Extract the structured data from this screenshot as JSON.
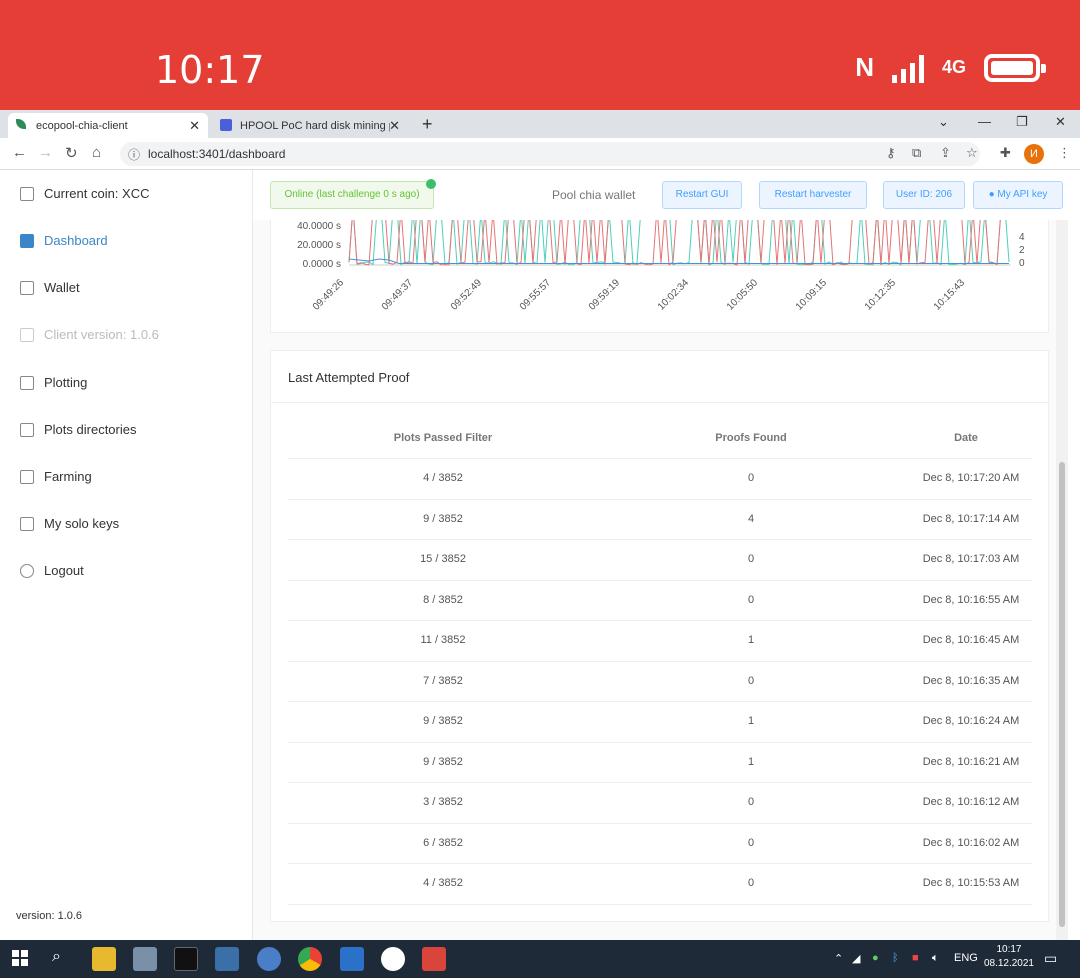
{
  "phone": {
    "time": "10:17",
    "network": "4G"
  },
  "browser": {
    "tabs": [
      {
        "label": "ecopool-chia-client",
        "active": true
      },
      {
        "label": "HPOOL PoC hard disk mining po",
        "active": false
      }
    ],
    "url": "localhost:3401/dashboard"
  },
  "sidebar": {
    "items": [
      {
        "label": "Current coin: XCC",
        "icon": "coin-icon"
      },
      {
        "label": "Dashboard",
        "icon": "dashboard-icon",
        "active": true
      },
      {
        "label": "Wallet",
        "icon": "wallet-icon"
      },
      {
        "label": "Client version: 1.0.6",
        "icon": "download-icon",
        "disabled": true
      },
      {
        "label": "Plotting",
        "icon": "plotting-icon"
      },
      {
        "label": "Plots directories",
        "icon": "folder-icon"
      },
      {
        "label": "Farming",
        "icon": "farming-icon"
      },
      {
        "label": "My solo keys",
        "icon": "lock-icon"
      },
      {
        "label": "Logout",
        "icon": "user-icon"
      }
    ],
    "version": "version: 1.0.6"
  },
  "topbar": {
    "status": "Online (last challenge 0 s ago)",
    "wallet": "Pool chia wallet",
    "restart_gui": "Restart GUI",
    "restart_harvester": "Restart harvester",
    "user_id": "User ID: 206",
    "api_key": "My API key"
  },
  "chart_data": {
    "type": "line",
    "y_left_ticks": [
      "40.0000 s",
      "20.0000 s",
      "0.0000 s"
    ],
    "y_right_ticks": [
      "4",
      "2",
      "0"
    ],
    "x_ticks": [
      "09:49:26",
      "09:49:37",
      "09:52:49",
      "09:55:57",
      "09:59:19",
      "10:02:34",
      "10:05:50",
      "10:09:15",
      "10:12:35",
      "10:15:43"
    ],
    "colors": {
      "red": "#e57373",
      "teal": "#4dd0b8",
      "blue": "#4a90d9"
    }
  },
  "proof": {
    "title": "Last Attempted Proof",
    "headers": [
      "Plots Passed Filter",
      "Proofs Found",
      "Date"
    ],
    "rows": [
      [
        "4 / 3852",
        "0",
        "Dec 8, 10:17:20 AM"
      ],
      [
        "9 / 3852",
        "4",
        "Dec 8, 10:17:14 AM"
      ],
      [
        "15 / 3852",
        "0",
        "Dec 8, 10:17:03 AM"
      ],
      [
        "8 / 3852",
        "0",
        "Dec 8, 10:16:55 AM"
      ],
      [
        "11 / 3852",
        "1",
        "Dec 8, 10:16:45 AM"
      ],
      [
        "7 / 3852",
        "0",
        "Dec 8, 10:16:35 AM"
      ],
      [
        "9 / 3852",
        "1",
        "Dec 8, 10:16:24 AM"
      ],
      [
        "9 / 3852",
        "1",
        "Dec 8, 10:16:21 AM"
      ],
      [
        "3 / 3852",
        "0",
        "Dec 8, 10:16:12 AM"
      ],
      [
        "6 / 3852",
        "0",
        "Dec 8, 10:16:02 AM"
      ],
      [
        "4 / 3852",
        "0",
        "Dec 8, 10:15:53 AM"
      ]
    ]
  },
  "taskbar": {
    "lang": "ENG",
    "time": "10:17",
    "date": "08.12.2021"
  }
}
